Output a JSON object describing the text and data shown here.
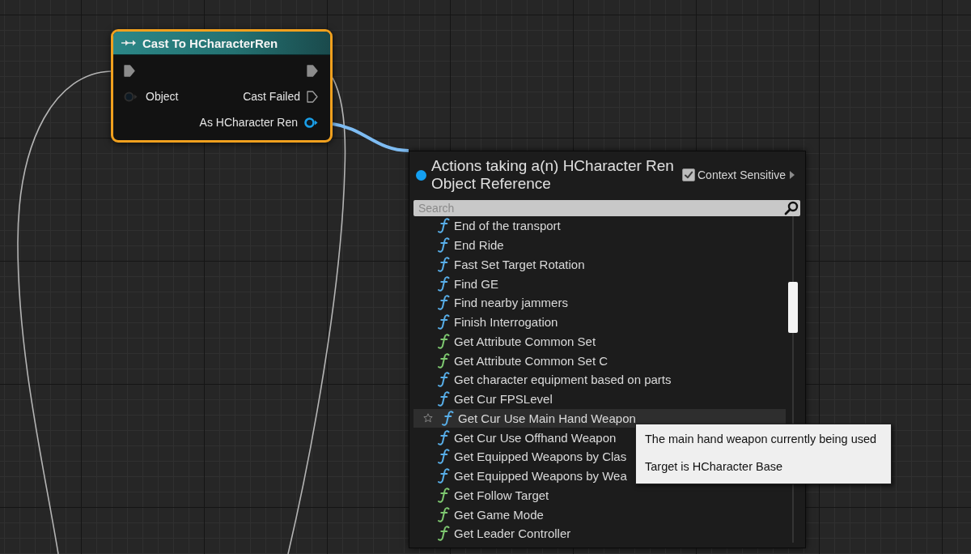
{
  "graph": {
    "node": {
      "title": "Cast To HCharacterRen",
      "selected": true,
      "rows": [
        {
          "left": {
            "kind": "exec",
            "connected": true
          },
          "right": {
            "kind": "exec",
            "connected": true
          }
        },
        {
          "left": {
            "kind": "data",
            "label": "Object",
            "connected": false
          },
          "right": {
            "kind": "exec",
            "label": "Cast Failed",
            "connected": false
          }
        },
        {
          "right": {
            "kind": "data",
            "label": "As HCharacter Ren",
            "connected": true
          }
        }
      ]
    }
  },
  "action_menu": {
    "title": "Actions taking a(n) HCharacter Ren Object Reference",
    "context_sensitive": {
      "label": "Context Sensitive",
      "checked": true
    },
    "search": {
      "placeholder": "Search"
    },
    "items": [
      {
        "label": "End of the transport",
        "color": "#58aee8",
        "highlighted": false
      },
      {
        "label": "End Ride",
        "color": "#58aee8",
        "highlighted": false
      },
      {
        "label": "Fast Set Target Rotation",
        "color": "#58aee8",
        "highlighted": false
      },
      {
        "label": "Find GE",
        "color": "#58aee8",
        "highlighted": false
      },
      {
        "label": "Find nearby jammers",
        "color": "#58aee8",
        "highlighted": false
      },
      {
        "label": "Finish Interrogation",
        "color": "#58aee8",
        "highlighted": false
      },
      {
        "label": "Get Attribute Common Set",
        "color": "#7ec870",
        "highlighted": false
      },
      {
        "label": "Get Attribute Common Set C",
        "color": "#7ec870",
        "highlighted": false
      },
      {
        "label": "Get character equipment based on parts",
        "color": "#58aee8",
        "highlighted": false
      },
      {
        "label": "Get Cur FPSLevel",
        "color": "#58aee8",
        "highlighted": false
      },
      {
        "label": "Get Cur Use Main Hand Weapon",
        "color": "#58aee8",
        "highlighted": true
      },
      {
        "label": "Get Cur Use Offhand Weapon",
        "color": "#58aee8",
        "highlighted": false
      },
      {
        "label": "Get Equipped Weapons by Clas",
        "color": "#58aee8",
        "highlighted": false
      },
      {
        "label": "Get Equipped Weapons by Wea",
        "color": "#58aee8",
        "highlighted": false
      },
      {
        "label": "Get Follow Target",
        "color": "#7ec870",
        "highlighted": false
      },
      {
        "label": "Get Game Mode",
        "color": "#7ec870",
        "highlighted": false
      },
      {
        "label": "Get Leader Controller",
        "color": "#7ec870",
        "highlighted": false
      }
    ]
  },
  "tooltip": {
    "lines": [
      "The main hand weapon currently being used",
      "Target is HCharacter Base"
    ]
  }
}
